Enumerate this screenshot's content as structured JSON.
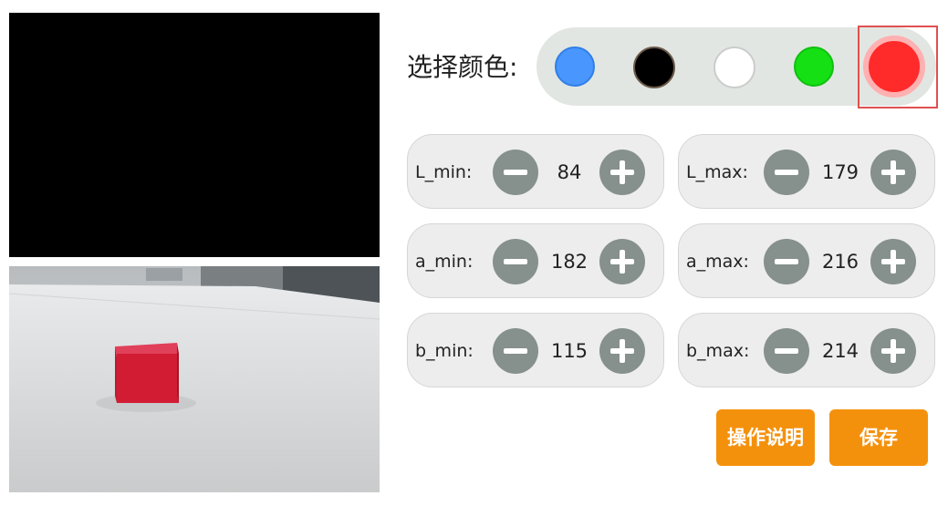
{
  "color_selector": {
    "label": "选择颜色:",
    "colors": [
      {
        "name": "blue",
        "hex": "#4a96ff",
        "border": "#2f7fe6"
      },
      {
        "name": "black",
        "hex": "#000000",
        "border": "#6b5a4a"
      },
      {
        "name": "white",
        "hex": "#ffffff",
        "border": "#cccccc"
      },
      {
        "name": "green",
        "hex": "#14e014",
        "border": "#10c010"
      },
      {
        "name": "red",
        "hex": "#ff2a2a",
        "border": "#ffb0b0"
      }
    ],
    "selected": "red"
  },
  "params": {
    "L_min": {
      "label": "L_min:",
      "value": "84"
    },
    "L_max": {
      "label": "L_max:",
      "value": "179"
    },
    "a_min": {
      "label": "a_min:",
      "value": "182"
    },
    "a_max": {
      "label": "a_max:",
      "value": "216"
    },
    "b_min": {
      "label": "b_min:",
      "value": "115"
    },
    "b_max": {
      "label": "b_max:",
      "value": "214"
    }
  },
  "buttons": {
    "instructions_label": "操作说明",
    "save_label": "保存"
  },
  "theme": {
    "accent": "#f4910c",
    "step_button": "#86908c"
  },
  "icons": {
    "decrement": "minus-icon",
    "increment": "plus-icon"
  }
}
